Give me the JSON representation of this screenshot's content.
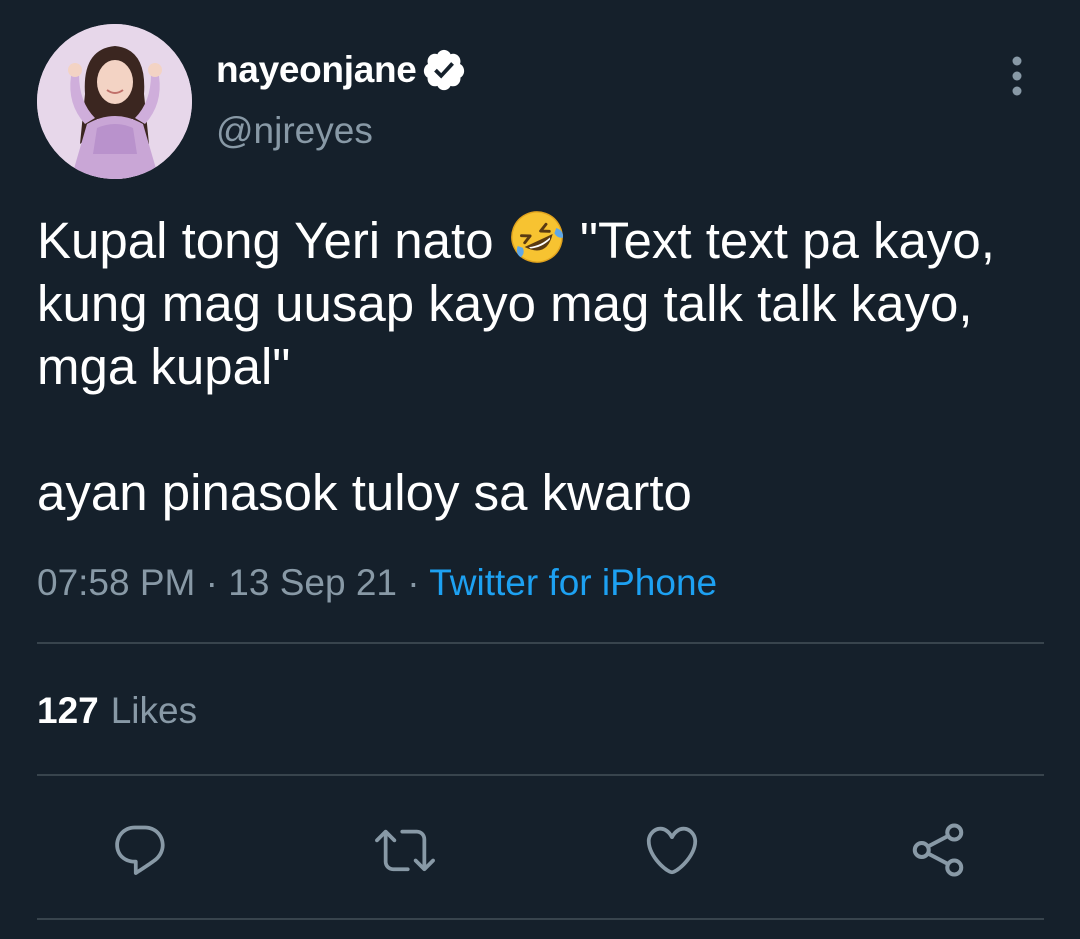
{
  "user": {
    "display_name": "nayeonjane",
    "handle": "@njreyes",
    "verified": true
  },
  "tweet": {
    "text_part1": "Kupal tong Yeri nato ",
    "emoji": "rolling-on-the-floor-laughing",
    "text_part2": " \"Text text pa kayo, kung mag uusap kayo mag talk talk kayo, mga kupal\"\n\nayan pinasok tuloy sa kwarto",
    "time": "07:58 PM",
    "separator1": " · ",
    "date": "13 Sep 21",
    "separator2": " · ",
    "source": "Twitter for iPhone"
  },
  "stats": {
    "likes_count": "127",
    "likes_label": "Likes"
  },
  "actions": [
    "reply-icon",
    "retweet-icon",
    "like-icon",
    "share-icon"
  ],
  "colors": {
    "background": "#15202b",
    "secondary_text": "#8899a6",
    "accent": "#1da1f2",
    "divider": "#38444d"
  }
}
